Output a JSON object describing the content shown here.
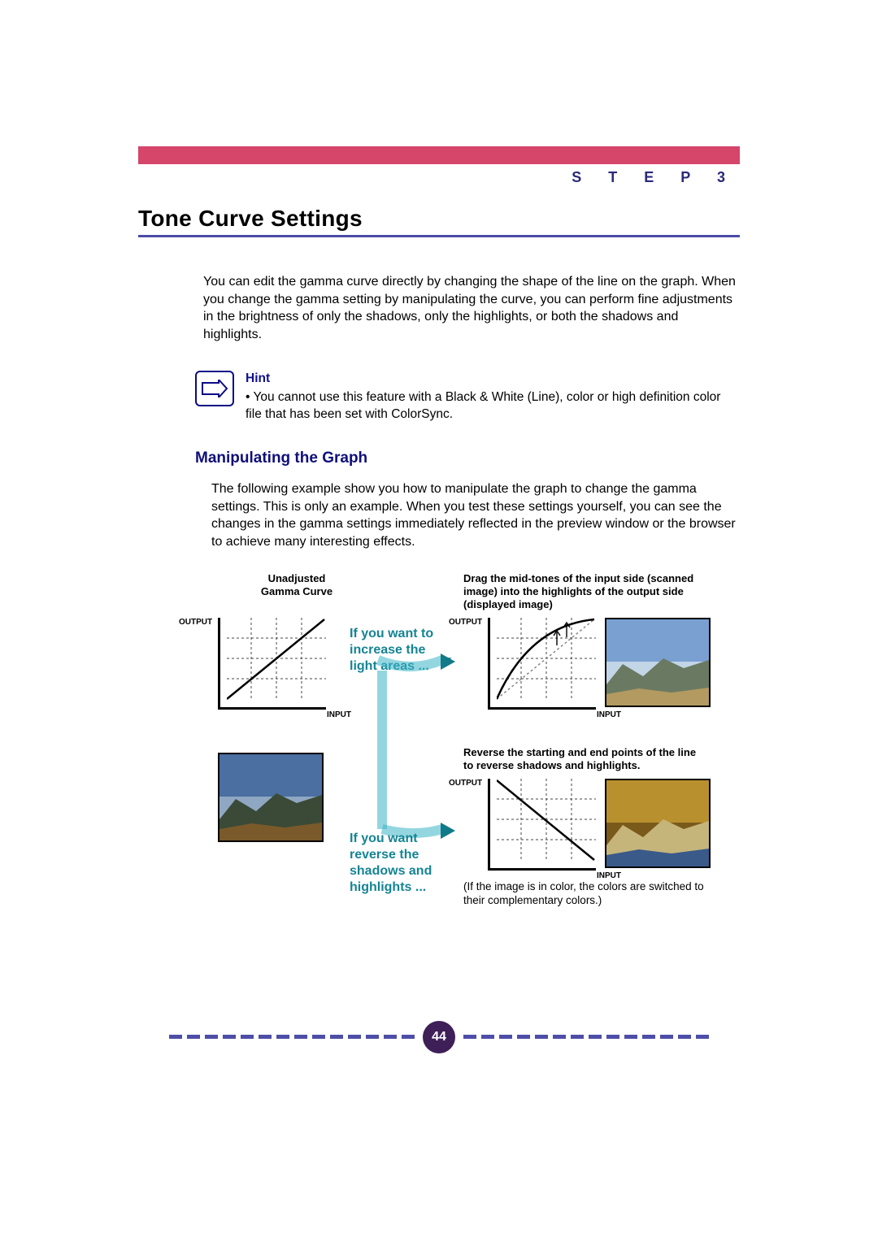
{
  "header": {
    "step": "S T E P   3",
    "title": "Tone Curve Settings"
  },
  "intro": "You can edit the gamma curve directly by changing the shape of the line on the graph. When you change the gamma setting by manipulating the curve, you can perform fine adjustments in the brightness of only the shadows, only the highlights, or both the shadows and highlights.",
  "hint": {
    "heading": "Hint",
    "body": "• You cannot use this feature with a Black & White (Line), color or high definition color file that has been set with ColorSync."
  },
  "sub": {
    "heading": "Manipulating the Graph",
    "body": "The following example show you how to manipulate the graph to change the gamma settings.  This is only an example.  When you test these settings yourself, you can see the changes in the gamma settings immediately reflected in the preview window or the browser to achieve many interesting effects."
  },
  "diagram": {
    "unadjusted_label": "Unadjusted\nGamma Curve",
    "output_label": "OUTPUT",
    "input_label": "INPUT",
    "increase_light": "If you want to\nincrease the\nlight areas ...",
    "reverse_shadows": "If you want\nreverse the\nshadows and\nhighlights ...",
    "drag_midtones": "Drag the mid-tones of the input side (scanned image) into the highlights of the output side (displayed image)",
    "reverse_points": "Reverse the starting and end points of the line to reverse shadows and highlights.",
    "color_note": "(If the image is in color, the colors are switched to their complementary colors.)"
  },
  "page_number": "44"
}
